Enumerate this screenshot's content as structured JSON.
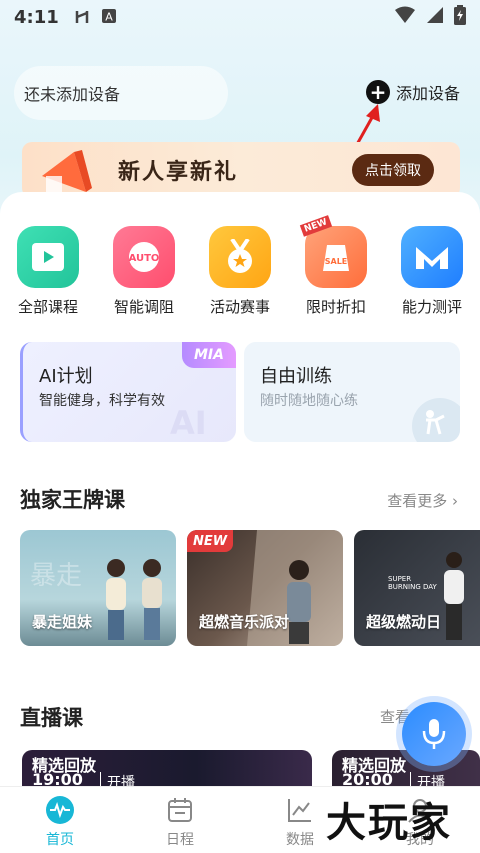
{
  "status_bar": {
    "time": "4:11"
  },
  "device": {
    "none_text": "还未添加设备",
    "add_label": "添加设备"
  },
  "banner": {
    "title": "新人享新礼",
    "claim_label": "点击领取"
  },
  "categories": [
    {
      "label": "全部课程",
      "icon": "play-icon",
      "color": "#2ecfa3"
    },
    {
      "label": "智能调阻",
      "icon": "auto-icon",
      "color": "#ff5c7a"
    },
    {
      "label": "活动赛事",
      "icon": "medal-icon",
      "color": "#ffb020"
    },
    {
      "label": "限时折扣",
      "icon": "sale-tag-icon",
      "color": "#ff7a3d"
    },
    {
      "label": "能力测评",
      "icon": "m-logo-icon",
      "color": "#2f8cff"
    }
  ],
  "plans": {
    "ai": {
      "title": "AI计划",
      "subtitle": "智能健身，科学有效",
      "tag": "MIA"
    },
    "free": {
      "title": "自由训练",
      "subtitle": "随时随地随心练"
    }
  },
  "exclusive": {
    "title": "独家王牌课",
    "more": "查看更多",
    "courses": [
      {
        "label": "暴走姐妹"
      },
      {
        "label": "超燃音乐派对",
        "tag": "NEW"
      },
      {
        "label": "超级燃动日",
        "caption": "SUPER BURNING DAY"
      }
    ]
  },
  "live": {
    "title": "直播课",
    "more": "查看",
    "items": [
      {
        "badge": "精选回放",
        "time": "19:00",
        "status": "开播"
      },
      {
        "badge": "精选回放",
        "time": "20:00",
        "status": "开播"
      }
    ]
  },
  "bottom_nav": [
    {
      "label": "首页",
      "active": true
    },
    {
      "label": "日程",
      "active": false
    },
    {
      "label": "数据",
      "active": false
    },
    {
      "label": "我的",
      "active": false
    }
  ],
  "watermark": "大玩家",
  "colors": {
    "accent": "#18b7d6",
    "banner_button": "#5b2a12"
  }
}
